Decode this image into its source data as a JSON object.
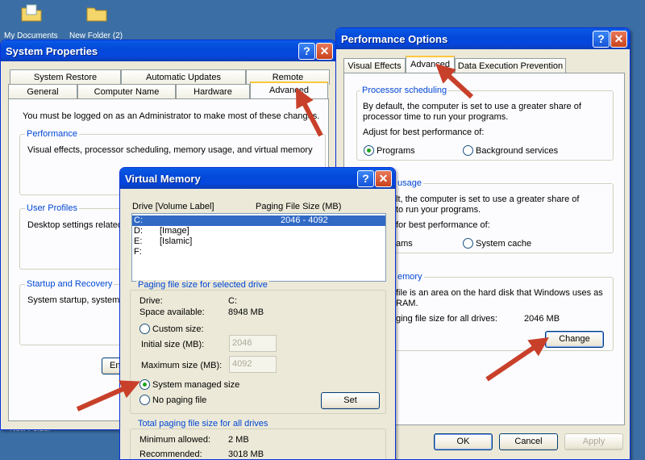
{
  "desktop": {
    "icons": [
      {
        "label": "My Documents"
      },
      {
        "label": "New Folder (2)"
      }
    ],
    "bottom_label": "New Folder"
  },
  "system_properties": {
    "title": "System Properties",
    "tabs_row1": [
      "System Restore",
      "Automatic Updates",
      "Remote"
    ],
    "tabs_row2": [
      "General",
      "Computer Name",
      "Hardware",
      "Advanced"
    ],
    "intro": "You must be logged on as an Administrator to make most of these changes.",
    "performance": {
      "label": "Performance",
      "text": "Visual effects, processor scheduling, memory usage, and virtual memory"
    },
    "user_profiles": {
      "label": "User Profiles",
      "text": "Desktop settings related"
    },
    "startup": {
      "label": "Startup and Recovery",
      "text": "System startup, system f"
    },
    "env_button_partial": "En"
  },
  "performance_options": {
    "title": "Performance Options",
    "tabs": [
      "Visual Effects",
      "Advanced",
      "Data Execution Prevention"
    ],
    "processor_scheduling": {
      "label": "Processor scheduling",
      "text1": "By default, the computer is set to use a greater share of",
      "text2": "processor time to run your programs.",
      "adjust": "Adjust for best performance of:",
      "opt_programs": "Programs",
      "opt_background": "Background services"
    },
    "memory_usage": {
      "label": "usage",
      "text1": "lt, the computer is set to use a greater share of",
      "text2": "to run your programs.",
      "adjust": "for best performance of:",
      "opt_programs": "ams",
      "opt_cache": "System cache"
    },
    "virtual_memory": {
      "label": "emory",
      "text1": "file is an area on the hard disk that Windows uses as",
      "text2": "RAM.",
      "total_label": "ging file size for all drives:",
      "total_value": "2046 MB",
      "change_button": "Change"
    },
    "ok": "OK",
    "cancel": "Cancel",
    "apply": "Apply"
  },
  "virtual_memory": {
    "title": "Virtual Memory",
    "col_drive": "Drive  [Volume Label]",
    "col_paging": "Paging File Size (MB)",
    "drives": [
      {
        "drive": "C:",
        "label": "",
        "size": "2046 - 4092"
      },
      {
        "drive": "D:",
        "label": "[Image]",
        "size": ""
      },
      {
        "drive": "E:",
        "label": "[Islamic]",
        "size": ""
      },
      {
        "drive": "F:",
        "label": "",
        "size": ""
      }
    ],
    "selected_group": {
      "label": "Paging file size for selected drive",
      "drive_label": "Drive:",
      "drive_value": "C:",
      "space_label": "Space available:",
      "space_value": "8948 MB",
      "custom_size": "Custom size:",
      "initial_label": "Initial size (MB):",
      "initial_value": "2046",
      "max_label": "Maximum size (MB):",
      "max_value": "4092",
      "system_managed": "System managed size",
      "no_paging": "No paging file",
      "set_button": "Set"
    },
    "total_group": {
      "label": "Total paging file size for all drives",
      "min_label": "Minimum allowed:",
      "min_value": "2 MB",
      "rec_label": "Recommended:",
      "rec_value": "3018 MB"
    }
  },
  "colors": {
    "desktop": "#3a6ea5",
    "titlebar": "#0348d8",
    "annotation_arrow": "#c8402a",
    "group_label": "#0046d5"
  }
}
